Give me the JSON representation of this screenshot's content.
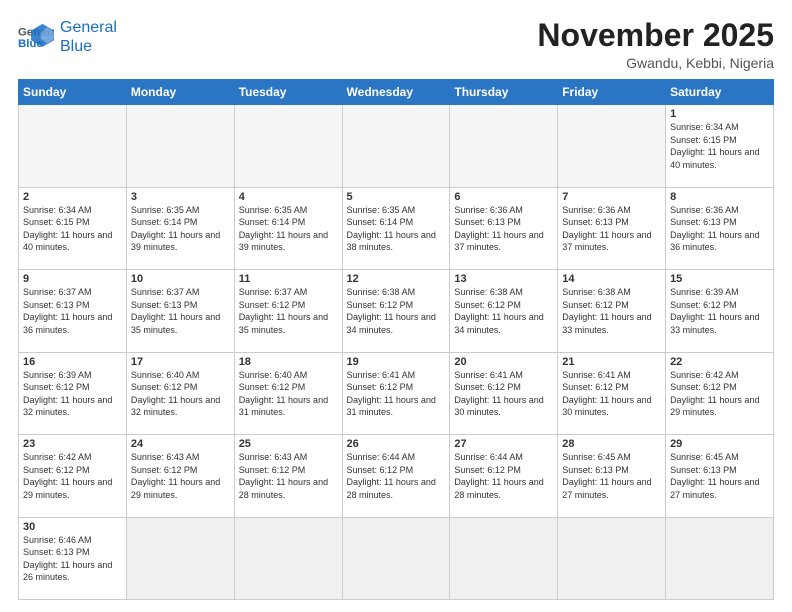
{
  "header": {
    "logo_general": "General",
    "logo_blue": "Blue",
    "month_title": "November 2025",
    "location": "Gwandu, Kebbi, Nigeria"
  },
  "weekdays": [
    "Sunday",
    "Monday",
    "Tuesday",
    "Wednesday",
    "Thursday",
    "Friday",
    "Saturday"
  ],
  "weeks": [
    [
      {
        "day": "",
        "info": ""
      },
      {
        "day": "",
        "info": ""
      },
      {
        "day": "",
        "info": ""
      },
      {
        "day": "",
        "info": ""
      },
      {
        "day": "",
        "info": ""
      },
      {
        "day": "",
        "info": ""
      },
      {
        "day": "1",
        "info": "Sunrise: 6:34 AM\nSunset: 6:15 PM\nDaylight: 11 hours\nand 40 minutes."
      }
    ],
    [
      {
        "day": "2",
        "info": "Sunrise: 6:34 AM\nSunset: 6:15 PM\nDaylight: 11 hours\nand 40 minutes."
      },
      {
        "day": "3",
        "info": "Sunrise: 6:35 AM\nSunset: 6:14 PM\nDaylight: 11 hours\nand 39 minutes."
      },
      {
        "day": "4",
        "info": "Sunrise: 6:35 AM\nSunset: 6:14 PM\nDaylight: 11 hours\nand 39 minutes."
      },
      {
        "day": "5",
        "info": "Sunrise: 6:35 AM\nSunset: 6:14 PM\nDaylight: 11 hours\nand 38 minutes."
      },
      {
        "day": "6",
        "info": "Sunrise: 6:36 AM\nSunset: 6:13 PM\nDaylight: 11 hours\nand 37 minutes."
      },
      {
        "day": "7",
        "info": "Sunrise: 6:36 AM\nSunset: 6:13 PM\nDaylight: 11 hours\nand 37 minutes."
      },
      {
        "day": "8",
        "info": "Sunrise: 6:36 AM\nSunset: 6:13 PM\nDaylight: 11 hours\nand 36 minutes."
      }
    ],
    [
      {
        "day": "9",
        "info": "Sunrise: 6:37 AM\nSunset: 6:13 PM\nDaylight: 11 hours\nand 36 minutes."
      },
      {
        "day": "10",
        "info": "Sunrise: 6:37 AM\nSunset: 6:13 PM\nDaylight: 11 hours\nand 35 minutes."
      },
      {
        "day": "11",
        "info": "Sunrise: 6:37 AM\nSunset: 6:12 PM\nDaylight: 11 hours\nand 35 minutes."
      },
      {
        "day": "12",
        "info": "Sunrise: 6:38 AM\nSunset: 6:12 PM\nDaylight: 11 hours\nand 34 minutes."
      },
      {
        "day": "13",
        "info": "Sunrise: 6:38 AM\nSunset: 6:12 PM\nDaylight: 11 hours\nand 34 minutes."
      },
      {
        "day": "14",
        "info": "Sunrise: 6:38 AM\nSunset: 6:12 PM\nDaylight: 11 hours\nand 33 minutes."
      },
      {
        "day": "15",
        "info": "Sunrise: 6:39 AM\nSunset: 6:12 PM\nDaylight: 11 hours\nand 33 minutes."
      }
    ],
    [
      {
        "day": "16",
        "info": "Sunrise: 6:39 AM\nSunset: 6:12 PM\nDaylight: 11 hours\nand 32 minutes."
      },
      {
        "day": "17",
        "info": "Sunrise: 6:40 AM\nSunset: 6:12 PM\nDaylight: 11 hours\nand 32 minutes."
      },
      {
        "day": "18",
        "info": "Sunrise: 6:40 AM\nSunset: 6:12 PM\nDaylight: 11 hours\nand 31 minutes."
      },
      {
        "day": "19",
        "info": "Sunrise: 6:41 AM\nSunset: 6:12 PM\nDaylight: 11 hours\nand 31 minutes."
      },
      {
        "day": "20",
        "info": "Sunrise: 6:41 AM\nSunset: 6:12 PM\nDaylight: 11 hours\nand 30 minutes."
      },
      {
        "day": "21",
        "info": "Sunrise: 6:41 AM\nSunset: 6:12 PM\nDaylight: 11 hours\nand 30 minutes."
      },
      {
        "day": "22",
        "info": "Sunrise: 6:42 AM\nSunset: 6:12 PM\nDaylight: 11 hours\nand 29 minutes."
      }
    ],
    [
      {
        "day": "23",
        "info": "Sunrise: 6:42 AM\nSunset: 6:12 PM\nDaylight: 11 hours\nand 29 minutes."
      },
      {
        "day": "24",
        "info": "Sunrise: 6:43 AM\nSunset: 6:12 PM\nDaylight: 11 hours\nand 29 minutes."
      },
      {
        "day": "25",
        "info": "Sunrise: 6:43 AM\nSunset: 6:12 PM\nDaylight: 11 hours\nand 28 minutes."
      },
      {
        "day": "26",
        "info": "Sunrise: 6:44 AM\nSunset: 6:12 PM\nDaylight: 11 hours\nand 28 minutes."
      },
      {
        "day": "27",
        "info": "Sunrise: 6:44 AM\nSunset: 6:12 PM\nDaylight: 11 hours\nand 28 minutes."
      },
      {
        "day": "28",
        "info": "Sunrise: 6:45 AM\nSunset: 6:13 PM\nDaylight: 11 hours\nand 27 minutes."
      },
      {
        "day": "29",
        "info": "Sunrise: 6:45 AM\nSunset: 6:13 PM\nDaylight: 11 hours\nand 27 minutes."
      }
    ],
    [
      {
        "day": "30",
        "info": "Sunrise: 6:46 AM\nSunset: 6:13 PM\nDaylight: 11 hours\nand 26 minutes."
      },
      {
        "day": "",
        "info": ""
      },
      {
        "day": "",
        "info": ""
      },
      {
        "day": "",
        "info": ""
      },
      {
        "day": "",
        "info": ""
      },
      {
        "day": "",
        "info": ""
      },
      {
        "day": "",
        "info": ""
      }
    ]
  ]
}
